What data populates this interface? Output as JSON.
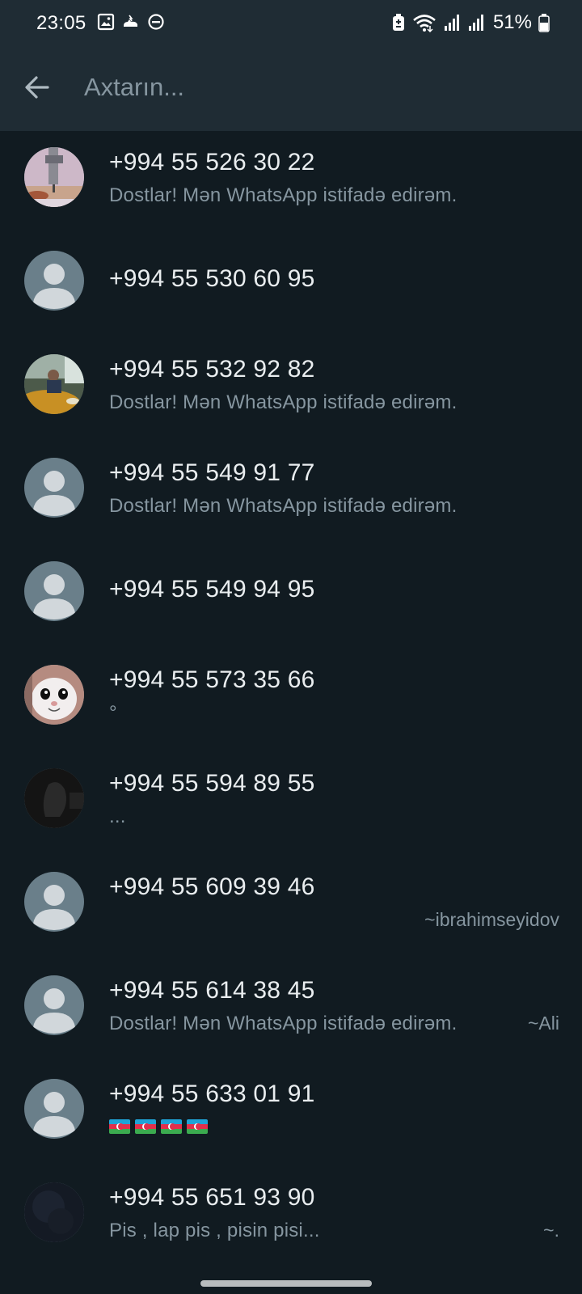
{
  "status_bar": {
    "time": "23:05",
    "battery_percent": "51%",
    "left_icons": [
      "gallery-icon",
      "camera-flash-icon",
      "do-not-disturb-icon"
    ],
    "right_icons": [
      "battery-saver-icon",
      "wifi-icon",
      "signal-icon",
      "signal-icon",
      "battery-icon"
    ]
  },
  "search": {
    "placeholder": "Axtarın..."
  },
  "colors": {
    "background": "#111b21",
    "header": "#1f2c34",
    "text_primary": "#e9edef",
    "text_secondary": "#8696a0",
    "default_avatar": "#6a7f8a"
  },
  "contacts": [
    {
      "name": "+994 55 526 30 22",
      "about": "Dostlar! Mən WhatsApp istifadə edirəm.",
      "pushname": "",
      "avatar": "photo-sewing-machine"
    },
    {
      "name": "+994 55 530 60 95",
      "about": "",
      "pushname": "",
      "avatar": "default"
    },
    {
      "name": "+994 55 532 92 82",
      "about": "Dostlar! Mən WhatsApp istifadə edirəm.",
      "pushname": "",
      "avatar": "photo-person-cafe"
    },
    {
      "name": "+994 55 549 91 77",
      "about": "Dostlar! Mən WhatsApp istifadə edirəm.",
      "pushname": "",
      "avatar": "default"
    },
    {
      "name": "+994 55 549 94 95",
      "about": "",
      "pushname": "",
      "avatar": "default"
    },
    {
      "name": "+994 55 573 35 66",
      "about": "°",
      "pushname": "",
      "avatar": "photo-cat"
    },
    {
      "name": "+994 55 594 89 55",
      "about": "...",
      "pushname": "",
      "avatar": "photo-dark"
    },
    {
      "name": "+994 55 609 39 46",
      "about": "",
      "pushname": "~ibrahimseyidov",
      "avatar": "default"
    },
    {
      "name": "+994 55 614 38 45",
      "about": "Dostlar! Mən WhatsApp istifadə edirəm.",
      "pushname": "~Ali",
      "avatar": "default"
    },
    {
      "name": "+994 55 633 01 91",
      "about": "",
      "pushname": "",
      "avatar": "default",
      "about_emoji": "azerbaijan-flag x4"
    },
    {
      "name": "+994 55 651 93 90",
      "about": "Pis , lap pis , pisin pisi...",
      "pushname": "~.",
      "avatar": "photo-dark-night"
    }
  ]
}
